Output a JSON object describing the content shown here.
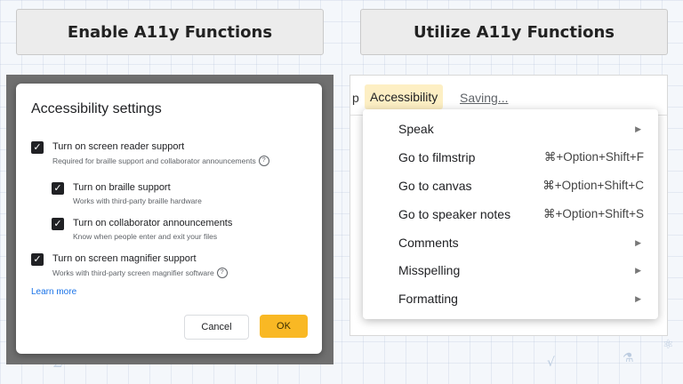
{
  "headers": {
    "left": "Enable A11y Functions",
    "right": "Utilize A11y Functions"
  },
  "dialog": {
    "title": "Accessibility settings",
    "options": [
      {
        "label": "Turn on screen reader support",
        "sub": "Required for braille support and collaborator announcements",
        "checked": true,
        "help": true
      },
      {
        "label": "Turn on braille support",
        "sub": "Works with third-party braille hardware",
        "checked": true,
        "help": false
      },
      {
        "label": "Turn on collaborator announcements",
        "sub": "Know when people enter and exit your files",
        "checked": true,
        "help": false
      },
      {
        "label": "Turn on screen magnifier support",
        "sub": "Works with third-party screen magnifier software",
        "checked": true,
        "help": true
      }
    ],
    "learn_more": "Learn more",
    "cancel_label": "Cancel",
    "ok_label": "OK",
    "help_glyph": "?",
    "check_glyph": "✓"
  },
  "menubar": {
    "partial": "p",
    "accessibility": "Accessibility",
    "saving": "Saving..."
  },
  "menu": {
    "items": [
      {
        "label": "Speak",
        "shortcut": "",
        "submenu": true
      },
      {
        "label": "Go to filmstrip",
        "shortcut": "⌘+Option+Shift+F",
        "submenu": false
      },
      {
        "label": "Go to canvas",
        "shortcut": "⌘+Option+Shift+C",
        "submenu": false
      },
      {
        "label": "Go to speaker notes",
        "shortcut": "⌘+Option+Shift+S",
        "submenu": false
      },
      {
        "label": "Comments",
        "shortcut": "",
        "submenu": true
      },
      {
        "label": "Misspelling",
        "shortcut": "",
        "submenu": true
      },
      {
        "label": "Formatting",
        "shortcut": "",
        "submenu": true
      }
    ],
    "arrow_glyph": "▶"
  },
  "colors": {
    "ok_button": "#f9b824",
    "menu_highlight": "#fdefc4",
    "link": "#1a73e8"
  }
}
